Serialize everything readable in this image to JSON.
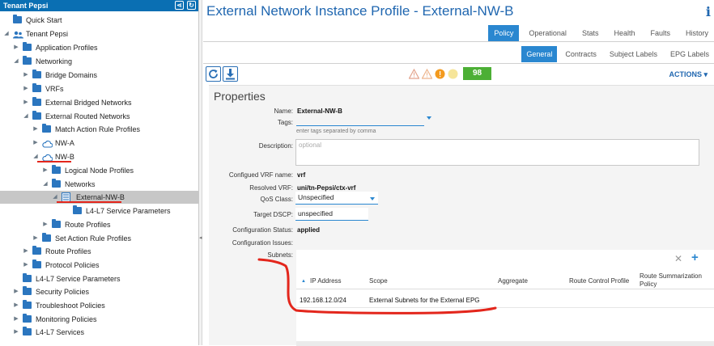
{
  "left_panel": {
    "header": "Tenant Pepsi",
    "tree": [
      {
        "label": "Quick Start"
      },
      {
        "label": "Tenant Pepsi"
      },
      {
        "label": "Application Profiles"
      },
      {
        "label": "Networking"
      },
      {
        "label": "Bridge Domains"
      },
      {
        "label": "VRFs"
      },
      {
        "label": "External Bridged Networks"
      },
      {
        "label": "External Routed Networks"
      },
      {
        "label": "Match Action Rule Profiles"
      },
      {
        "label": "NW-A"
      },
      {
        "label": "NW-B"
      },
      {
        "label": "Logical Node Profiles"
      },
      {
        "label": "Networks"
      },
      {
        "label": "External-NW-B"
      },
      {
        "label": "L4-L7 Service Parameters"
      },
      {
        "label": "Route Profiles"
      },
      {
        "label": "Set Action Rule Profiles"
      },
      {
        "label": "Route Profiles"
      },
      {
        "label": "Protocol Policies"
      },
      {
        "label": "L4-L7 Service Parameters"
      },
      {
        "label": "Security Policies"
      },
      {
        "label": "Troubleshoot Policies"
      },
      {
        "label": "Monitoring Policies"
      },
      {
        "label": "L4-L7 Services"
      }
    ]
  },
  "page": {
    "title": "External Network Instance Profile - External-NW-B",
    "info_glyph": "i"
  },
  "tabs_primary": [
    {
      "label": "Policy",
      "active": true
    },
    {
      "label": "Operational",
      "active": false
    },
    {
      "label": "Stats",
      "active": false
    },
    {
      "label": "Health",
      "active": false
    },
    {
      "label": "Faults",
      "active": false
    },
    {
      "label": "History",
      "active": false
    }
  ],
  "tabs_secondary": [
    {
      "label": "General",
      "active": true
    },
    {
      "label": "Contracts",
      "active": false
    },
    {
      "label": "Subject Labels",
      "active": false
    },
    {
      "label": "EPG Labels",
      "active": false
    }
  ],
  "toolbar": {
    "health_score": "98",
    "actions_label": "ACTIONS",
    "icons": [
      "refresh-icon",
      "download-icon"
    ]
  },
  "properties": {
    "heading": "Properties",
    "name_label": "Name:",
    "name_value": "External-NW-B",
    "tags_label": "Tags:",
    "tags_hint": "enter tags separated by comma",
    "description_label": "Description:",
    "description_placeholder": "optional",
    "configured_vrf_label": "Configued VRF name:",
    "configured_vrf_value": "vrf",
    "resolved_vrf_label": "Resolved VRF:",
    "resolved_vrf_value": "uni/tn-Pepsi/ctx-vrf",
    "qos_label": "QoS Class:",
    "qos_value": "Unspecified",
    "dscp_label": "Target DSCP:",
    "dscp_value": "unspecified",
    "config_status_label": "Configuration Status:",
    "config_status_value": "applied",
    "config_issues_label": "Configuration Issues:",
    "subnets_label": "Subnets:"
  },
  "subnets": {
    "columns": [
      "IP Address",
      "Scope",
      "Aggregate",
      "Route Control Profile",
      "Route Summarization Policy"
    ],
    "rows": [
      {
        "ip": "192.168.12.0/24",
        "scope": "External Subnets for the External EPG",
        "aggregate": "",
        "route_control_profile": "",
        "route_summarization_policy": ""
      }
    ]
  },
  "colors": {
    "accent": "#2a87d0",
    "header_blue": "#0a6fb3",
    "annotation_red": "#e3261c",
    "health_green": "#4caf35"
  }
}
